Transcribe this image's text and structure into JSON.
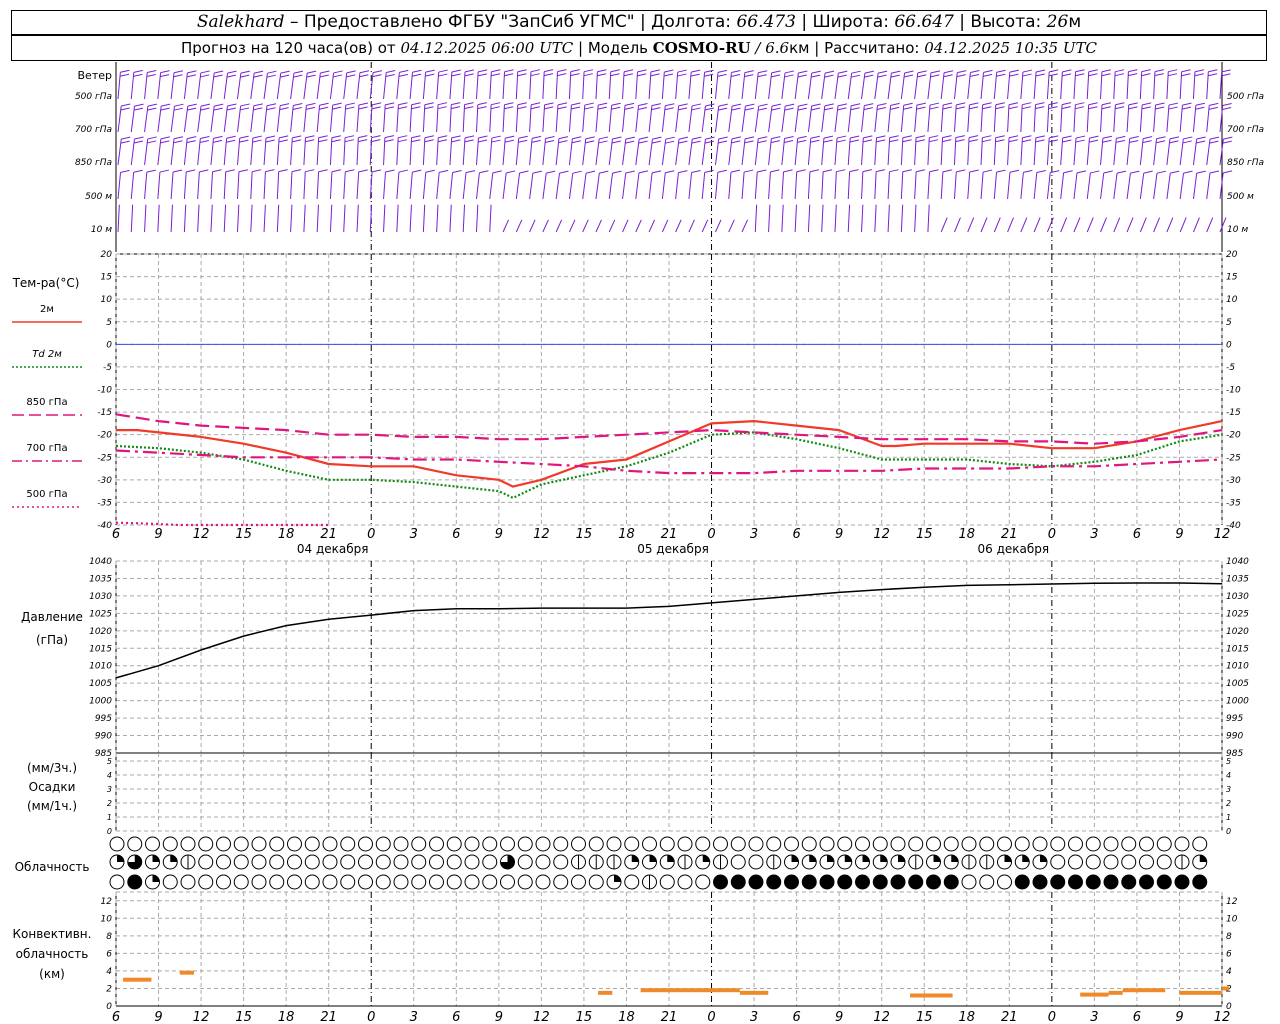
{
  "header": {
    "station": "Salekhard",
    "dash": "–",
    "provided_by": "Предоставлено ФГБУ \"ЗапСиб УГМС\"",
    "lon_label": "Долгота:",
    "lon_value": "66.473",
    "lat_label": "Широта:",
    "lat_value": "66.647",
    "alt_label": "Высота:",
    "alt_value": "26",
    "alt_unit": "м",
    "forecast_label": "Прогноз на 120 часа(ов) от",
    "forecast_start": "04.12.2025 06:00 UTC",
    "model_label": "Модель",
    "model_name": "COSMO-RU",
    "model_sep": "/",
    "model_res": "6.6",
    "model_res_unit": "км",
    "calc_label": "Рассчитано:",
    "calc_time": "04.12.2025 10:35 UTC",
    "sep": "|"
  },
  "colors": {
    "wind": "#7a1fd2",
    "t2m": "#f03a2a",
    "td2m": "#138a13",
    "level": "#e0157f",
    "pressure": "#000000",
    "conv": "#ee8a2a",
    "zero_line": "#3550e0",
    "grid": "#aaaaaa"
  },
  "wind_panel": {
    "label": "Ветер",
    "levels": [
      "500 гПа",
      "700 гПа",
      "850 гПа",
      "500 м",
      "10 м"
    ]
  },
  "temp_panel": {
    "title": "Тем-ра(°С)",
    "legend": [
      {
        "label": "2м",
        "style": "solid",
        "color": "#f03a2a"
      },
      {
        "label": "Td  2м",
        "style": "dotted",
        "color": "#138a13"
      },
      {
        "label": "850 гПа",
        "style": "dash",
        "color": "#e0157f"
      },
      {
        "label": "700 гПа",
        "style": "dashdot",
        "color": "#e0157f"
      },
      {
        "label": "500 гПа",
        "style": "dots",
        "color": "#e0157f"
      }
    ]
  },
  "pressure_panel": {
    "label1": "Давление",
    "label2": "(гПа)"
  },
  "precip_panel": {
    "label1": "(мм/3ч.)",
    "label2": "Осадки",
    "label3": "(мм/1ч.)"
  },
  "cloud_panel": {
    "label": "Облачность"
  },
  "conv_panel": {
    "label1": "Конвективн.",
    "label2": "облачность",
    "label3": "(км)"
  },
  "date_labels": [
    {
      "text": "04 декабря",
      "hour": 15
    },
    {
      "text": "05 декабря",
      "hour": 39
    },
    {
      "text": "06 декабря",
      "hour": 63
    }
  ],
  "chart_data": [
    {
      "type": "line",
      "name": "temperature",
      "ylim": [
        -40,
        20
      ],
      "yticks": [
        -40,
        -35,
        -30,
        -25,
        -20,
        -15,
        -10,
        -5,
        0,
        5,
        10,
        15,
        20
      ],
      "x_hours": [
        0,
        3,
        6,
        9,
        12,
        15,
        18,
        21,
        24,
        27,
        30,
        33,
        36,
        39,
        42,
        45,
        48,
        51,
        54,
        57,
        60,
        63,
        66,
        69,
        72,
        75,
        78
      ],
      "xtick_labels": [
        "6",
        "9",
        "12",
        "15",
        "18",
        "21",
        "0",
        "3",
        "6",
        "9",
        "12",
        "15",
        "18",
        "21",
        "0",
        "3",
        "6",
        "9",
        "12",
        "15",
        "18",
        "21",
        "0",
        "3",
        "6",
        "9",
        "12"
      ],
      "series": [
        {
          "name": "2м",
          "x": [
            0,
            1.5,
            3,
            6,
            9,
            12,
            15,
            18,
            21,
            24,
            27,
            28,
            30,
            33,
            36,
            39,
            42,
            45,
            48,
            51,
            54,
            55,
            57,
            60,
            63,
            66,
            69,
            72,
            75,
            78
          ],
          "values": [
            -19,
            -19,
            -19.5,
            -20.5,
            -22,
            -24,
            -26.5,
            -27,
            -27,
            -29,
            -30,
            -31.5,
            -30,
            -26.5,
            -25.5,
            -21.5,
            -17.5,
            -17,
            -18,
            -19,
            -22.5,
            -22.5,
            -22,
            -22,
            -22,
            -23,
            -23,
            -21.5,
            -19,
            -17
          ]
        },
        {
          "name": "Td  2м",
          "x": [
            0,
            3,
            6,
            9,
            12,
            15,
            18,
            21,
            24,
            27,
            28,
            30,
            33,
            36,
            39,
            42,
            45,
            48,
            51,
            54,
            57,
            60,
            63,
            66,
            69,
            72,
            75,
            78
          ],
          "values": [
            -22.5,
            -23,
            -24,
            -25.5,
            -28,
            -30,
            -30,
            -30.5,
            -31.5,
            -32.5,
            -34,
            -31,
            -29,
            -27,
            -24,
            -20,
            -19.5,
            -21,
            -23,
            -25.5,
            -25.5,
            -25.5,
            -26.5,
            -27,
            -26,
            -24.5,
            -21.5,
            -20
          ]
        },
        {
          "name": "850 гПа",
          "x": [
            0,
            3,
            6,
            9,
            12,
            15,
            18,
            21,
            24,
            27,
            30,
            33,
            36,
            39,
            42,
            45,
            48,
            51,
            54,
            57,
            60,
            63,
            66,
            69,
            72,
            75,
            78
          ],
          "values": [
            -15.5,
            -17,
            -18,
            -18.5,
            -19,
            -20,
            -20,
            -20.5,
            -20.5,
            -21,
            -21,
            -20.5,
            -20,
            -19.5,
            -19,
            -19.5,
            -20,
            -20.5,
            -21,
            -21,
            -21,
            -21.5,
            -21.5,
            -22,
            -21.5,
            -20.5,
            -19
          ]
        },
        {
          "name": "700 гПа",
          "x": [
            0,
            3,
            6,
            9,
            12,
            15,
            18,
            21,
            24,
            27,
            30,
            33,
            36,
            39,
            42,
            45,
            48,
            51,
            54,
            57,
            60,
            63,
            66,
            69,
            72,
            75,
            78
          ],
          "values": [
            -23.5,
            -24,
            -24.5,
            -25,
            -25,
            -25,
            -25,
            -25.5,
            -25.5,
            -26,
            -26.5,
            -27,
            -28,
            -28.5,
            -28.5,
            -28.5,
            -28,
            -28,
            -28,
            -27.5,
            -27.5,
            -27.5,
            -27,
            -27,
            -26.5,
            -26,
            -25.5
          ]
        },
        {
          "name": "500 гПа",
          "x": [
            0,
            1.5,
            3,
            4.5,
            6,
            9,
            12,
            15
          ],
          "values": [
            -39.5,
            -39.6,
            -39.8,
            -40,
            -40,
            -40,
            -40,
            -40
          ]
        }
      ]
    },
    {
      "type": "line",
      "name": "pressure",
      "ylim": [
        985,
        1040
      ],
      "yticks": [
        985,
        990,
        995,
        1000,
        1005,
        1010,
        1015,
        1020,
        1025,
        1030,
        1035,
        1040
      ],
      "x": [
        0,
        3,
        6,
        9,
        12,
        15,
        18,
        21,
        24,
        27,
        30,
        33,
        36,
        39,
        42,
        45,
        48,
        51,
        54,
        57,
        60,
        63,
        66,
        69,
        72,
        75,
        78
      ],
      "series": [
        {
          "name": "Давление",
          "values": [
            1006.5,
            1010,
            1014.5,
            1018.5,
            1021.5,
            1023.3,
            1024.5,
            1025.8,
            1026.3,
            1026.3,
            1026.5,
            1026.5,
            1026.5,
            1027,
            1028,
            1029,
            1030,
            1031,
            1031.8,
            1032.5,
            1033,
            1033.2,
            1033.4,
            1033.6,
            1033.7,
            1033.7,
            1033.5
          ]
        }
      ]
    },
    {
      "type": "bar",
      "name": "precipitation",
      "ylim": [
        0,
        5
      ],
      "yticks": [
        0,
        1,
        2,
        3,
        4,
        5
      ],
      "values": []
    },
    {
      "type": "table",
      "name": "cloudiness",
      "values": {
        "row1": "000000000000000000000000000000000000000000000000000000000000000000000000000000",
        "row2": "232210000000000000000030001112221210012222222122112220000000122210000000001110000000000000000",
        "row3": "042000000000000000000000000020100044444444444444000444444444444444444400000000000000444444"
      }
    },
    {
      "type": "bar",
      "name": "convective_cloud",
      "ylim": [
        0,
        13
      ],
      "yticks": [
        0,
        2,
        4,
        6,
        8,
        10,
        12
      ],
      "bars": [
        {
          "x0": 0.5,
          "x1": 2.5,
          "value": 3
        },
        {
          "x0": 4.5,
          "x1": 5.5,
          "value": 3.8
        },
        {
          "x0": 34,
          "x1": 35,
          "value": 1.5
        },
        {
          "x0": 37,
          "x1": 44,
          "value": 1.8
        },
        {
          "x0": 44,
          "x1": 46,
          "value": 1.5
        },
        {
          "x0": 56,
          "x1": 59,
          "value": 1.2
        },
        {
          "x0": 68,
          "x1": 70,
          "value": 1.3
        },
        {
          "x0": 70,
          "x1": 71,
          "value": 1.5
        },
        {
          "x0": 71,
          "x1": 74,
          "value": 1.8
        },
        {
          "x0": 75,
          "x1": 78,
          "value": 1.5
        },
        {
          "x0": 78,
          "x1": 78.5,
          "value": 2
        }
      ]
    }
  ]
}
